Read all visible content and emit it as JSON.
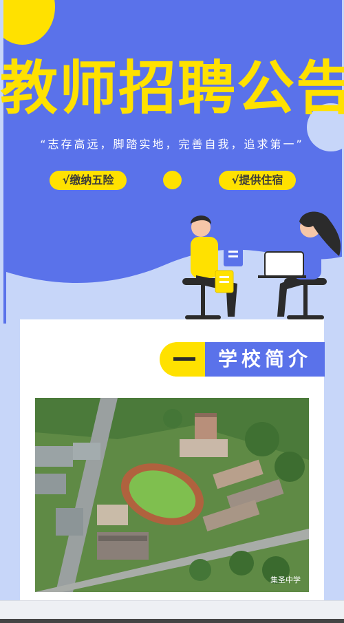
{
  "header": {
    "title": "教师招聘公告",
    "slogan": "“志存高远，脚踏实地，完善自我，追求第一”"
  },
  "benefits": [
    "√缴纳五险",
    "√提供住宿"
  ],
  "section": {
    "number_label": "一",
    "title": "学校简介"
  },
  "photo": {
    "watermark": "集圣中学"
  },
  "colors": {
    "primary_blue": "#5a72ea",
    "accent_yellow": "#ffe100",
    "light_blue": "#c7d6f9"
  }
}
